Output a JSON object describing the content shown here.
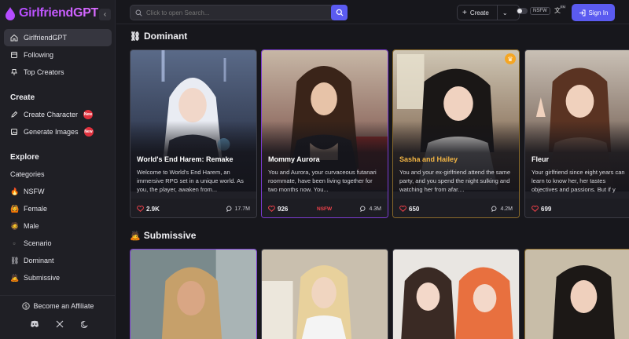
{
  "app": {
    "name": "GirlfriendGPT"
  },
  "colors": {
    "accent": "#5b5bf0",
    "brand": "#c65bff",
    "nsfw": "#f0414a",
    "premium": "#f5a623"
  },
  "sidebar": {
    "nav": [
      {
        "label": "GirlfriendGPT",
        "icon": "home-icon",
        "active": true
      },
      {
        "label": "Following",
        "icon": "following-icon"
      },
      {
        "label": "Top Creators",
        "icon": "pin-icon"
      }
    ],
    "create_title": "Create",
    "create_items": [
      {
        "label": "Create Character",
        "badge": "New"
      },
      {
        "label": "Generate Images",
        "badge": "New"
      }
    ],
    "explore_title": "Explore",
    "explore_items": [
      {
        "label": "Categories",
        "emoji": ""
      },
      {
        "label": "NSFW",
        "emoji": "🔥"
      },
      {
        "label": "Female",
        "emoji": "🙆"
      },
      {
        "label": "Male",
        "emoji": "🧔"
      },
      {
        "label": "Scenario",
        "emoji": "▫"
      },
      {
        "label": "Dominant",
        "emoji": "⛓"
      },
      {
        "label": "Submissive",
        "emoji": "🙇"
      }
    ],
    "affiliate_label": "Become an Affiliate"
  },
  "topbar": {
    "search_placeholder": "Click to open Search...",
    "create_label": "Create",
    "nsfw_label": "NSFW",
    "lang": "EN",
    "signin_label": "Sign In"
  },
  "sections": {
    "dominant_title": "Dominant",
    "submissive_title": "Submissive"
  },
  "cards": [
    {
      "name": "World's End Harem: Remake",
      "desc": "Welcome to World's End Harem, an immersive RPG set in a unique world. As you, the player, awaken from...",
      "likes": "2.9K",
      "chats": "17.7M",
      "nsfw": ""
    },
    {
      "name": "Mommy Aurora",
      "desc": "You and Aurora, your curvaceous futanari roommate, have been living together for two months now. You...",
      "likes": "926",
      "chats": "4.3M",
      "nsfw": "NSFW"
    },
    {
      "name": "Sasha and Hailey",
      "desc": "You and your ex-girlfriend attend the same party, and you spend the night sulking and watching her from afar....",
      "likes": "650",
      "chats": "4.2M",
      "nsfw": ""
    },
    {
      "name": "Fleur",
      "desc": "Your girlfriend since eight years can learn to know her, her tastes objectives and passions. But if y",
      "likes": "699",
      "chats": "",
      "nsfw": ""
    }
  ]
}
